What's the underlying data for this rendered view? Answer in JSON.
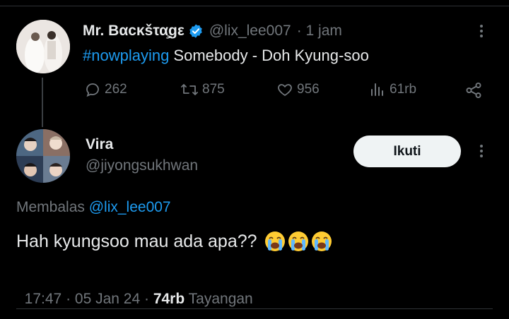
{
  "original_tweet": {
    "display_name": "Mr. Bαϲκšτα̧ɡε",
    "handle": "@lix_lee007",
    "time": "· 1 jam",
    "hashtag": "#nowplaying",
    "text": " Somebody - Doh Kyung-soo",
    "actions": {
      "reply_count": "262",
      "retweet_count": "875",
      "like_count": "956",
      "views_count": "61rb"
    }
  },
  "reply": {
    "display_name": "Vira",
    "handle": "@jiyongsukhwan",
    "follow_label": "Ikuti",
    "replying_label": "Membalas",
    "replying_handle": "@lix_lee007",
    "text": "Hah kyungsoo mau ada apa??",
    "emoji": [
      "loudly-crying-face",
      "loudly-crying-face",
      "loudly-crying-face"
    ],
    "time": "17:47",
    "sep1": " · ",
    "date": "05 Jan 24",
    "sep2": " · ",
    "views": "74rb",
    "views_label": "Tayangan"
  },
  "colors": {
    "background": "#000000",
    "text": "#e7e9ea",
    "muted": "#71767b",
    "link": "#1d9bf0",
    "verified": "#1d9bf0"
  }
}
